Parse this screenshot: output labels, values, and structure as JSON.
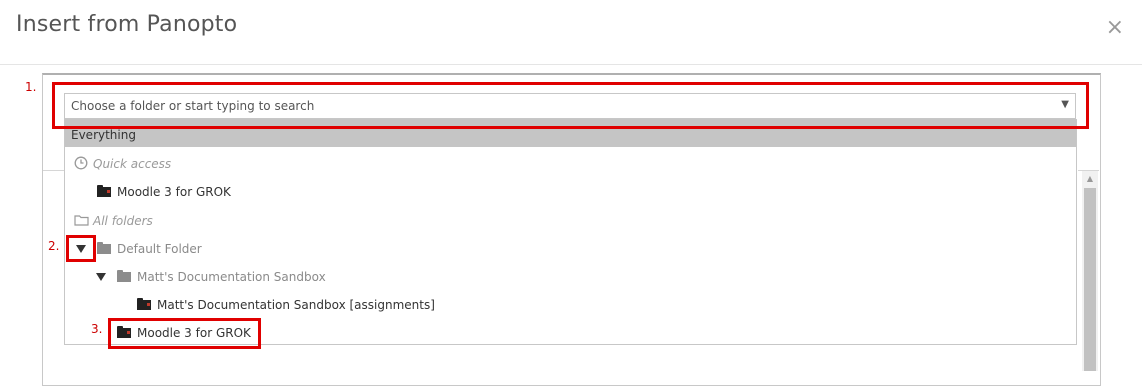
{
  "dialog": {
    "title": "Insert from Panopto",
    "close_label": "×"
  },
  "select": {
    "placeholder": "Choose a folder or start typing to search",
    "arrow": "▼"
  },
  "dropdown": {
    "everything": "Everything",
    "quick_access": {
      "label": "Quick access",
      "icon": "clock-icon"
    },
    "quick_items": [
      {
        "label": "Moodle 3 for GROK",
        "icon": "folder-icon"
      }
    ],
    "all_folders": {
      "label": "All folders",
      "icon": "folder-outline-icon"
    },
    "tree": {
      "default_folder": "Default Folder",
      "sandbox": "Matt's Documentation Sandbox",
      "sandbox_assignments": "Matt's Documentation Sandbox [assignments]",
      "moodle": "Moodle 3 for GROK"
    }
  },
  "annotations": {
    "a1": "1.",
    "a2": "2.",
    "a3": "3."
  },
  "colors": {
    "highlight": "#c5c5c5",
    "annotation_red": "#e00000"
  }
}
